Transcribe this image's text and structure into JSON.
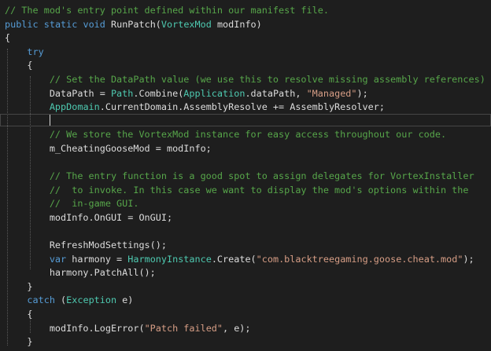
{
  "editor": {
    "lines": [
      [
        {
          "t": "// The mod's entry point defined within our manifest file.",
          "c": "comment"
        }
      ],
      [
        {
          "t": "public",
          "c": "keyword"
        },
        {
          "t": " ",
          "c": "plain"
        },
        {
          "t": "static",
          "c": "keyword"
        },
        {
          "t": " ",
          "c": "plain"
        },
        {
          "t": "void",
          "c": "keyword"
        },
        {
          "t": " RunPatch(",
          "c": "plain"
        },
        {
          "t": "VortexMod",
          "c": "type"
        },
        {
          "t": " modInfo)",
          "c": "plain"
        }
      ],
      [
        {
          "t": "{",
          "c": "plain"
        }
      ],
      [
        {
          "t": "    ",
          "c": "plain"
        },
        {
          "t": "try",
          "c": "keyword"
        }
      ],
      [
        {
          "t": "    {",
          "c": "plain"
        }
      ],
      [
        {
          "t": "        // Set the DataPath value (we use this to resolve missing assembly references)",
          "c": "comment"
        }
      ],
      [
        {
          "t": "        DataPath = ",
          "c": "plain"
        },
        {
          "t": "Path",
          "c": "type"
        },
        {
          "t": ".Combine(",
          "c": "plain"
        },
        {
          "t": "Application",
          "c": "type"
        },
        {
          "t": ".dataPath, ",
          "c": "plain"
        },
        {
          "t": "\"Managed\"",
          "c": "string"
        },
        {
          "t": ");",
          "c": "plain"
        }
      ],
      [
        {
          "t": "        ",
          "c": "plain"
        },
        {
          "t": "AppDomain",
          "c": "type"
        },
        {
          "t": ".CurrentDomain.AssemblyResolve += AssemblyResolver;",
          "c": "plain"
        }
      ],
      [
        {
          "t": "",
          "c": "plain"
        }
      ],
      [
        {
          "t": "        // We store the VortexMod instance for easy access throughout our code.",
          "c": "comment"
        }
      ],
      [
        {
          "t": "        m_CheatingGooseMod = modInfo;",
          "c": "plain"
        }
      ],
      [
        {
          "t": "",
          "c": "plain"
        }
      ],
      [
        {
          "t": "        // The entry function is a good spot to assign delegates for VortexInstaller",
          "c": "comment"
        }
      ],
      [
        {
          "t": "        //  to invoke. In this case we want to display the mod's options within the",
          "c": "comment"
        }
      ],
      [
        {
          "t": "        //  in-game GUI.",
          "c": "comment"
        }
      ],
      [
        {
          "t": "        modInfo.OnGUI = OnGUI;",
          "c": "plain"
        }
      ],
      [
        {
          "t": "",
          "c": "plain"
        }
      ],
      [
        {
          "t": "        RefreshModSettings();",
          "c": "plain"
        }
      ],
      [
        {
          "t": "        ",
          "c": "plain"
        },
        {
          "t": "var",
          "c": "keyword"
        },
        {
          "t": " harmony = ",
          "c": "plain"
        },
        {
          "t": "HarmonyInstance",
          "c": "type"
        },
        {
          "t": ".Create(",
          "c": "plain"
        },
        {
          "t": "\"com.blacktreegaming.goose.cheat.mod\"",
          "c": "string"
        },
        {
          "t": ");",
          "c": "plain"
        }
      ],
      [
        {
          "t": "        harmony.PatchAll();",
          "c": "plain"
        }
      ],
      [
        {
          "t": "    }",
          "c": "plain"
        }
      ],
      [
        {
          "t": "    ",
          "c": "plain"
        },
        {
          "t": "catch",
          "c": "keyword"
        },
        {
          "t": " (",
          "c": "plain"
        },
        {
          "t": "Exception",
          "c": "type"
        },
        {
          "t": " e)",
          "c": "plain"
        }
      ],
      [
        {
          "t": "    {",
          "c": "plain"
        }
      ],
      [
        {
          "t": "        modInfo.LogError(",
          "c": "plain"
        },
        {
          "t": "\"Patch failed\"",
          "c": "string"
        },
        {
          "t": ", e);",
          "c": "plain"
        }
      ],
      [
        {
          "t": "    }",
          "c": "plain"
        }
      ],
      [
        {
          "t": "}",
          "c": "plain"
        }
      ]
    ]
  }
}
